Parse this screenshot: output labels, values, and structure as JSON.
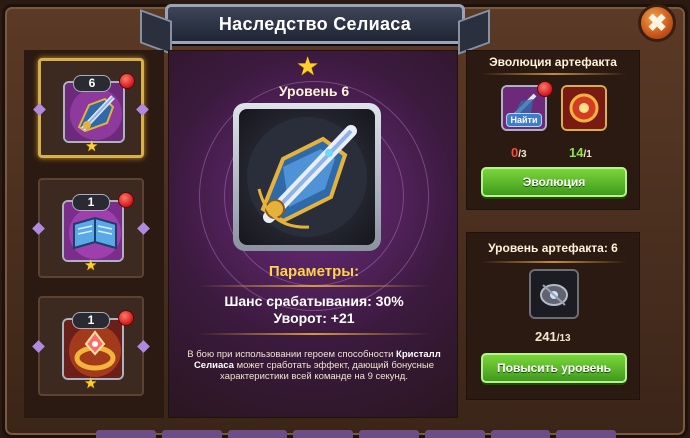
{
  "window": {
    "title": "Наследство Селиаса",
    "close_label": "✖"
  },
  "artifacts": [
    {
      "level": "6",
      "name": "Оружие",
      "has_alert": true,
      "stars": 1,
      "selected": true
    },
    {
      "level": "1",
      "name": "Книга",
      "has_alert": true,
      "stars": 1,
      "selected": false
    },
    {
      "level": "1",
      "name": "Кольцо",
      "has_alert": true,
      "stars": 1,
      "selected": false
    }
  ],
  "center": {
    "star": "★",
    "level_label": "Уровень 6",
    "params_title": "Параметры:",
    "stat_1": "Шанс срабатывания: 30%",
    "stat_2": "Уворот: +21",
    "description_prefix": "В бою при использовании героем способности",
    "description_skill": "Кристалл Селиаса",
    "description_suffix": "может сработать эффект, дающий бонусные характеристики всей команде на 9 секунд."
  },
  "evolution": {
    "title": "Эволюция артефакта",
    "find_label": "Найти",
    "item1_count": "0",
    "item1_total": "/3",
    "item2_count": "14",
    "item2_total": "/1",
    "button": "Эволюция"
  },
  "artifact_level": {
    "title": "Уровень артефакта: 6",
    "count": "241",
    "total": "/13",
    "button": "Повысить уровень"
  },
  "colors": {
    "accent_gold": "#ffd24a",
    "button_green": "#5cb82a",
    "count_red": "#ff4b3a",
    "count_green": "#8ee34a"
  }
}
